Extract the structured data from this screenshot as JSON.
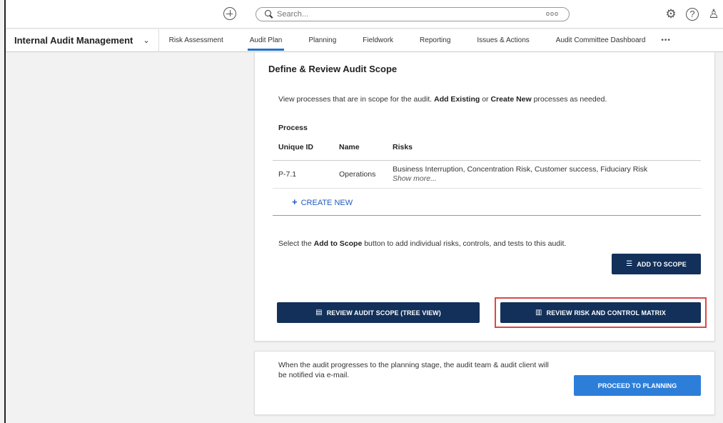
{
  "search": {
    "placeholder": "Search...",
    "more": "ooo"
  },
  "topbar": {
    "add_icon": "plus-circle-icon",
    "icons": [
      {
        "name": "gear-icon",
        "glyph": "⚙"
      },
      {
        "name": "help-icon",
        "glyph": "?"
      },
      {
        "name": "user-icon",
        "glyph": "♙"
      }
    ]
  },
  "nav": {
    "app_title": "Internal Audit Management",
    "chevron": "⌄",
    "tabs": [
      {
        "label": "Risk Assessment",
        "active": false
      },
      {
        "label": "Audit Plan",
        "active": true
      },
      {
        "label": "Planning",
        "active": false
      },
      {
        "label": "Fieldwork",
        "active": false
      },
      {
        "label": "Reporting",
        "active": false
      },
      {
        "label": "Issues & Actions",
        "active": false
      },
      {
        "label": "Audit Committee Dashboard",
        "active": false
      }
    ],
    "more": "•••"
  },
  "scope": {
    "title": "Define & Review Audit Scope",
    "intro_prefix": "View processes that are in scope for the audit.",
    "intro_b1": "Add Existing",
    "intro_mid": "or",
    "intro_b2": "Create New",
    "intro_suffix": "processes as needed.",
    "section_label": "Process",
    "columns": [
      "Unique ID",
      "Name",
      "Risks"
    ],
    "rows": [
      {
        "id": "P-7.1",
        "name": "Operations",
        "risks": "Business Interruption, Concentration Risk, Customer success, Fiduciary Risk",
        "show_more": "Show more..."
      }
    ],
    "create_new": "CREATE NEW",
    "hint_prefix": "Select the",
    "hint_b": "Add to Scope",
    "hint_suffix": "button to add individual risks, controls, and tests to this audit.",
    "add_to_scope": "ADD TO SCOPE",
    "review_tree": "REVIEW AUDIT SCOPE (TREE VIEW)",
    "review_matrix": "REVIEW RISK AND CONTROL MATRIX"
  },
  "proceed": {
    "text": "When the audit progresses to the planning stage, the audit team & audit client will be notified via e-mail.",
    "button": "PROCEED TO PLANNING"
  },
  "colors": {
    "accent": "#2472c8",
    "dark_button": "#12305a",
    "blue_button": "#2d7ed9",
    "highlight": "#e04646",
    "link": "#1f5bbf"
  }
}
